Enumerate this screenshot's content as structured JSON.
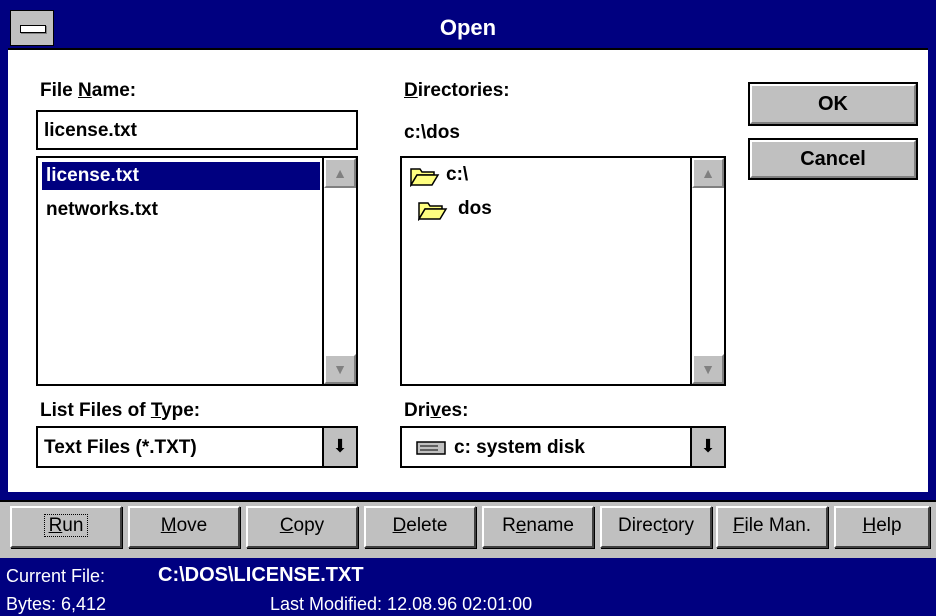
{
  "window": {
    "title": "Open"
  },
  "file_name": {
    "label": "File Name:",
    "value": "license.txt"
  },
  "file_list": {
    "items": [
      "license.txt",
      "networks.txt"
    ],
    "selected": "license.txt"
  },
  "directories": {
    "label": "Directories:",
    "current_path": "c:\\dos",
    "items": [
      "c:\\",
      "dos"
    ]
  },
  "file_type": {
    "label": "List Files of Type:",
    "value": "Text Files (*.TXT)"
  },
  "drives": {
    "label": "Drives:",
    "value": "c: system disk"
  },
  "buttons": {
    "ok": "OK",
    "cancel": "Cancel"
  },
  "toolbar": {
    "run": "Run",
    "move": "Move",
    "copy": "Copy",
    "delete": "Delete",
    "rename": "Rename",
    "directory": "Directory",
    "file_man": "File Man.",
    "help": "Help"
  },
  "status": {
    "current_file_label": "Current File:",
    "current_file_value": "C:\\DOS\\LICENSE.TXT",
    "bytes": "Bytes: 6,412",
    "last_modified": "Last Modified:  12.08.96 02:01:00"
  },
  "colors": {
    "title_bar": "#000080",
    "face": "#c0c0c0",
    "selection": "#000080",
    "folder": "#ffff80"
  }
}
